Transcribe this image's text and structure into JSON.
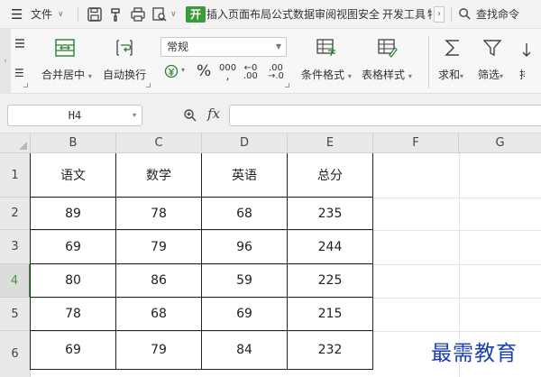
{
  "menubar": {
    "file_label": "文件",
    "tabs": [
      "开始",
      "插入",
      "页面布局",
      "公式",
      "数据",
      "审阅",
      "视图",
      "安全",
      "开发工具",
      "特"
    ],
    "active_tab": "开始",
    "search_label": "查找命令"
  },
  "ribbon": {
    "merge_label": "合并居中",
    "wrap_label": "自动换行",
    "number_format": "常规",
    "percent_symbol": "%",
    "thousands_symbol": "000",
    "inc_decimal_top": "←0",
    "inc_decimal_bottom": ".00",
    "dec_decimal_top": ".00",
    "dec_decimal_bottom": "→.0",
    "conditional_label": "条件格式",
    "table_style_label": "表格样式",
    "sum_label": "求和",
    "filter_label": "筛选",
    "sort_partial_label": "排"
  },
  "formula_bar": {
    "cell_ref": "H4",
    "fx_label": "fx",
    "formula_value": ""
  },
  "grid": {
    "columns": [
      "B",
      "C",
      "D",
      "E",
      "F",
      "G"
    ],
    "rows": [
      "1",
      "2",
      "3",
      "4",
      "5",
      "6"
    ],
    "selected_row": "4",
    "table": [
      [
        "语文",
        "数学",
        "英语",
        "总分"
      ],
      [
        "89",
        "78",
        "68",
        "235"
      ],
      [
        "69",
        "79",
        "96",
        "244"
      ],
      [
        "80",
        "86",
        "59",
        "225"
      ],
      [
        "78",
        "68",
        "69",
        "215"
      ],
      [
        "69",
        "79",
        "84",
        "232"
      ]
    ]
  },
  "watermark": "最需教育",
  "colors": {
    "accent_green": "#3c9a3c",
    "watermark_blue": "#1a3fb0"
  }
}
